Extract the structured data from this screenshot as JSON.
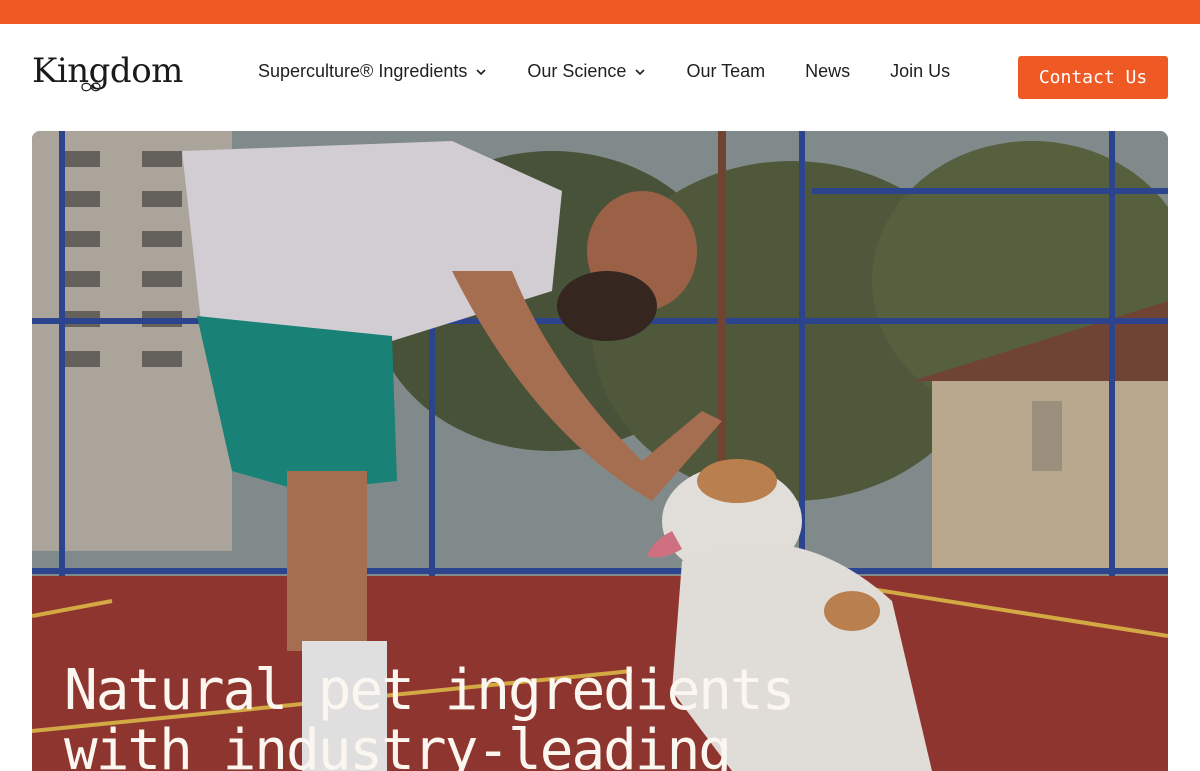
{
  "brand": {
    "name": "Kingdom",
    "accent": "#ef5a24"
  },
  "nav": {
    "items": [
      {
        "label": "Superculture® Ingredients",
        "has_dropdown": true
      },
      {
        "label": "Our Science",
        "has_dropdown": true
      },
      {
        "label": "Our Team",
        "has_dropdown": false
      },
      {
        "label": "News",
        "has_dropdown": false
      },
      {
        "label": "Join Us",
        "has_dropdown": false
      }
    ],
    "cta": "Contact Us"
  },
  "hero": {
    "title_line1": "Natural pet ingredients",
    "title_line2": "with industry-leading"
  }
}
